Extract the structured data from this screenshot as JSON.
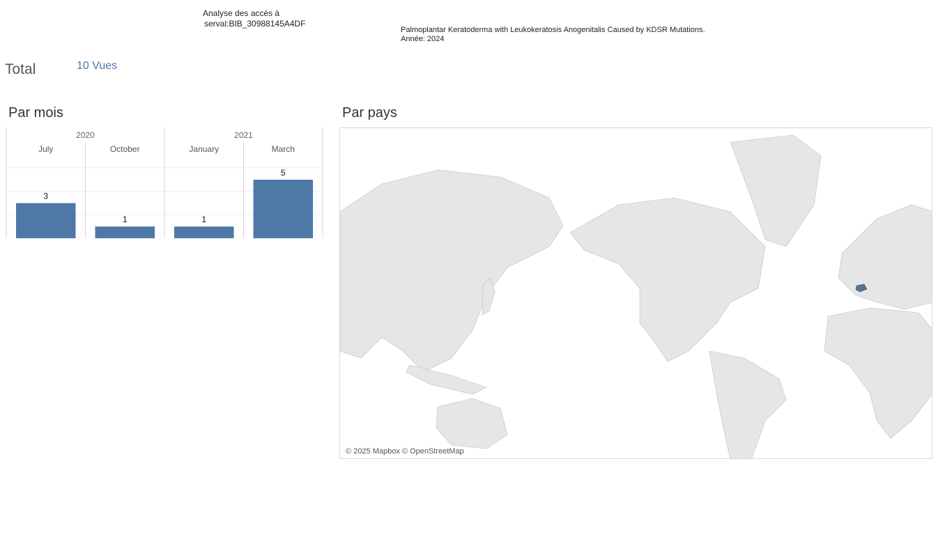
{
  "header": {
    "title_line1": "Analyse des accès à",
    "title_line2": "serval:BIB_30988145A4DF"
  },
  "publication": {
    "title": "Palmoplantar Keratoderma with Leukokeratosis Anogenitalis Caused by KDSR Mutations.",
    "year_line": "Année: 2024"
  },
  "total": {
    "label": "Total",
    "value": "10 Vues"
  },
  "sections": {
    "by_month": "Par mois",
    "by_country": "Par pays"
  },
  "map": {
    "attribution": "© 2025 Mapbox © OpenStreetMap",
    "highlight_color": "#5b7089",
    "land_color": "#e6e6e6",
    "border_color": "#999999"
  },
  "chart_data": {
    "type": "bar",
    "year_groups": [
      {
        "year": "2020",
        "months": [
          "July",
          "October"
        ]
      },
      {
        "year": "2021",
        "months": [
          "January",
          "March"
        ]
      }
    ],
    "categories": [
      "July",
      "October",
      "January",
      "March"
    ],
    "values": [
      3,
      1,
      1,
      5
    ],
    "ylim": [
      0,
      5
    ],
    "grid": true,
    "bar_color": "#4e79a7"
  }
}
